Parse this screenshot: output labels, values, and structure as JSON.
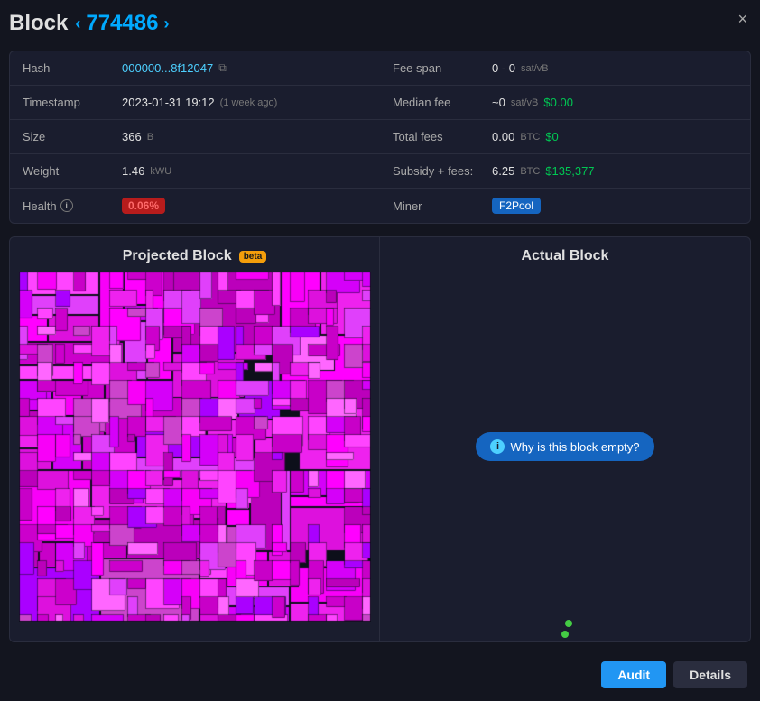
{
  "header": {
    "title": "Block",
    "block_number": "774486",
    "prev_arrow": "‹",
    "next_arrow": "›",
    "close": "×"
  },
  "info_left": {
    "rows": [
      {
        "label": "Hash",
        "value": "000000...8f12047",
        "value_type": "link",
        "extra": "copy"
      },
      {
        "label": "Timestamp",
        "value": "2023-01-31 19:12",
        "value_type": "text",
        "extra": "(1 week ago)"
      },
      {
        "label": "Size",
        "value": "366",
        "unit": "B",
        "value_type": "text"
      },
      {
        "label": "Weight",
        "value": "1.46",
        "unit": "kWU",
        "value_type": "text"
      },
      {
        "label": "Health",
        "value": "0.06%",
        "value_type": "badge_red",
        "has_info": true
      }
    ]
  },
  "info_right": {
    "rows": [
      {
        "label": "Fee span",
        "value": "0 - 0",
        "unit": "sat/vB",
        "value_type": "text"
      },
      {
        "label": "Median fee",
        "value": "~0",
        "unit": "sat/vB",
        "value_green": "$0.00"
      },
      {
        "label": "Total fees",
        "value": "0.00",
        "unit": "BTC",
        "value_green": "$0"
      },
      {
        "label": "Subsidy + fees:",
        "value": "6.25",
        "unit": "BTC",
        "value_green": "$135,377"
      },
      {
        "label": "Miner",
        "value": "F2Pool",
        "value_type": "badge_blue"
      }
    ]
  },
  "projected_block": {
    "title": "Projected Block",
    "beta_label": "beta"
  },
  "actual_block": {
    "title": "Actual Block",
    "empty_btn_label": "Why is this block empty?"
  },
  "footer": {
    "audit_label": "Audit",
    "details_label": "Details"
  },
  "colors": {
    "accent_blue": "#4dd0ff",
    "accent_green": "#00c853",
    "magenta": "#ff44ff",
    "bg_dark": "#13151f",
    "bg_mid": "#1a1d2e"
  }
}
